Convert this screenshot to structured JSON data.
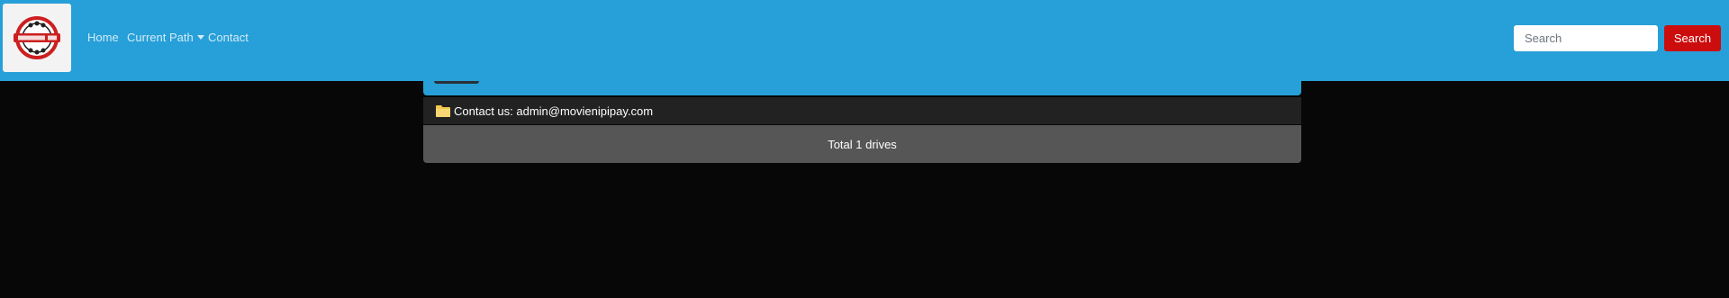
{
  "navbar": {
    "background": "#279fd8",
    "logo_icon": "site-logo",
    "links": {
      "home": "Home",
      "current_path": "Current Path",
      "contact": "Contact"
    },
    "search": {
      "placeholder": "Search",
      "value": "",
      "button_label": "Search",
      "button_color": "#cc0d0d"
    }
  },
  "main": {
    "contact_row": {
      "icon": "folder-icon",
      "text": "Contact us: admin@movienipipay.com"
    },
    "footer": {
      "total_text": "Total 1 drives"
    }
  }
}
